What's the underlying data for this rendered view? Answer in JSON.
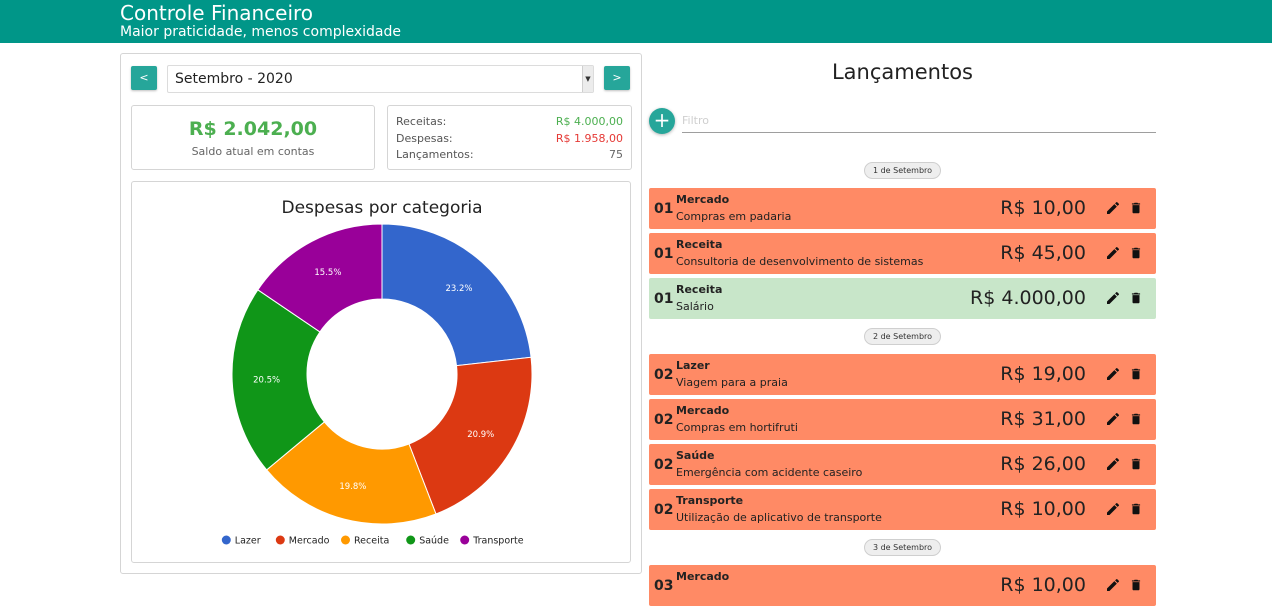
{
  "header": {
    "title": "Controle Financeiro",
    "subtitle": "Maior praticidade, menos complexidade"
  },
  "period": {
    "prev_label": "<",
    "next_label": ">",
    "selected": "Setembro - 2020"
  },
  "balance": {
    "amount": "R$ 2.042,00",
    "label": "Saldo atual em contas"
  },
  "summary": {
    "rows": [
      {
        "label": "Receitas:",
        "value": "R$ 4.000,00",
        "color": "#4caf50"
      },
      {
        "label": "Despesas:",
        "value": "R$ 1.958,00",
        "color": "#e53935"
      },
      {
        "label": "Lançamentos:",
        "value": "75",
        "color": "#666666"
      }
    ]
  },
  "chart_data": {
    "type": "pie",
    "title": "Despesas por categoria",
    "donut": true,
    "legend_position": "bottom",
    "slices": [
      {
        "name": "Lazer",
        "value": 23.2,
        "label": "23.2%",
        "color": "#3366cc"
      },
      {
        "name": "Mercado",
        "value": 20.9,
        "label": "20.9%",
        "color": "#dc3912"
      },
      {
        "name": "Receita",
        "value": 19.8,
        "label": "19.8%",
        "color": "#ff9900"
      },
      {
        "name": "Saúde",
        "value": 20.5,
        "label": "20.5%",
        "color": "#109618"
      },
      {
        "name": "Transporte",
        "value": 15.5,
        "label": "15.5%",
        "color": "#990099"
      }
    ]
  },
  "transactions": {
    "heading": "Lançamentos",
    "add_label": "+",
    "filter_placeholder": "Filtro",
    "groups": [
      {
        "date": "1 de Setembro",
        "items": [
          {
            "day": "01",
            "category": "Mercado",
            "description": "Compras em padaria",
            "amount": "R$ 10,00",
            "type": "expense"
          },
          {
            "day": "01",
            "category": "Receita",
            "description": "Consultoria de desenvolvimento de sistemas",
            "amount": "R$ 45,00",
            "type": "expense"
          },
          {
            "day": "01",
            "category": "Receita",
            "description": "Salário",
            "amount": "R$ 4.000,00",
            "type": "income"
          }
        ]
      },
      {
        "date": "2 de Setembro",
        "items": [
          {
            "day": "02",
            "category": "Lazer",
            "description": "Viagem para a praia",
            "amount": "R$ 19,00",
            "type": "expense"
          },
          {
            "day": "02",
            "category": "Mercado",
            "description": "Compras em hortifruti",
            "amount": "R$ 31,00",
            "type": "expense"
          },
          {
            "day": "02",
            "category": "Saúde",
            "description": "Emergência com acidente caseiro",
            "amount": "R$ 26,00",
            "type": "expense"
          },
          {
            "day": "02",
            "category": "Transporte",
            "description": "Utilização de aplicativo de transporte",
            "amount": "R$ 10,00",
            "type": "expense"
          }
        ]
      },
      {
        "date": "3 de Setembro",
        "items": [
          {
            "day": "03",
            "category": "Mercado",
            "description": "",
            "amount": "R$ 10,00",
            "type": "expense"
          }
        ]
      }
    ]
  }
}
